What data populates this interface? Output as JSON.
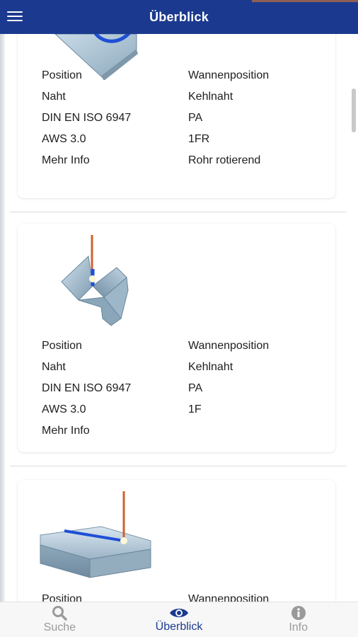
{
  "header": {
    "title": "Überblick"
  },
  "cards": [
    {
      "rows": [
        {
          "key": "Position",
          "value": "Wannenposition"
        },
        {
          "key": "Naht",
          "value": "Kehlnaht"
        },
        {
          "key": "DIN EN ISO 6947",
          "value": "PA"
        },
        {
          "key": "AWS 3.0",
          "value": "1FR"
        },
        {
          "key": "Mehr Info",
          "value": "Rohr rotierend"
        }
      ]
    },
    {
      "rows": [
        {
          "key": "Position",
          "value": "Wannenposition"
        },
        {
          "key": "Naht",
          "value": "Kehlnaht"
        },
        {
          "key": "DIN EN ISO 6947",
          "value": "PA"
        },
        {
          "key": "AWS 3.0",
          "value": "1F"
        },
        {
          "key": "Mehr Info",
          "value": ""
        }
      ]
    },
    {
      "rows": [
        {
          "key": "Position",
          "value": "Wannenposition"
        }
      ]
    }
  ],
  "bottom_nav": [
    {
      "label": "Suche",
      "icon": "search-icon",
      "active": false
    },
    {
      "label": "Überblick",
      "icon": "eye-icon",
      "active": true
    },
    {
      "label": "Info",
      "icon": "info-icon",
      "active": false
    }
  ],
  "colors": {
    "primary": "#1b3a8f",
    "inactive": "#9a9a9a"
  }
}
